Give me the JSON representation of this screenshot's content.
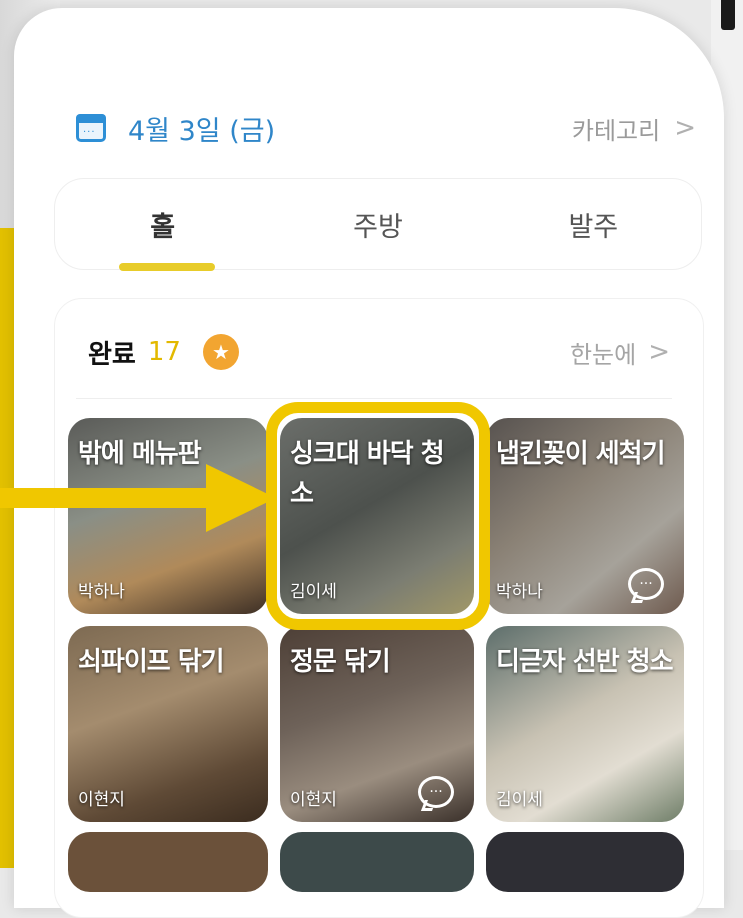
{
  "header": {
    "date": "4월 3일 (금)",
    "category_label": "카테고리",
    "category_chevron": ">"
  },
  "tabs": [
    {
      "label": "홀",
      "active": true
    },
    {
      "label": "주방",
      "active": false
    },
    {
      "label": "발주",
      "active": false
    }
  ],
  "completed": {
    "label": "완료",
    "count": "17",
    "glance_label": "한눈에",
    "glance_chevron": ">"
  },
  "tasks": [
    {
      "title": "밖에 메뉴판",
      "author": "박하나",
      "has_comment": false
    },
    {
      "title": "싱크대 바닥 청소",
      "author": "김이세",
      "has_comment": false,
      "highlighted": true
    },
    {
      "title": "냅킨꽂이 세척기",
      "author": "박하나",
      "has_comment": true
    },
    {
      "title": "쇠파이프 닦기",
      "author": "이현지",
      "has_comment": false
    },
    {
      "title": "정문 닦기",
      "author": "이현지",
      "has_comment": true
    },
    {
      "title": "디귿자 선반 청소",
      "author": "김이세",
      "has_comment": false
    }
  ],
  "colors": {
    "accent_yellow": "#f0c700",
    "date_blue": "#2f86c9",
    "badge_orange": "#f2a531"
  },
  "icons": {
    "calendar": "calendar-icon",
    "star": "star-badge-icon",
    "comment": "comment-icon"
  }
}
